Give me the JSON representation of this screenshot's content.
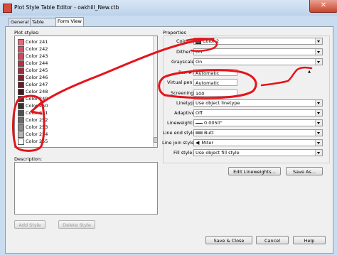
{
  "window": {
    "title": "Plot Style Table Editor - oakhill_New.ctb",
    "close_glyph": "✕"
  },
  "tabs": [
    {
      "label": "General"
    },
    {
      "label": "Table View"
    },
    {
      "label": "Form View"
    }
  ],
  "plot_styles": {
    "label": "Plot styles:",
    "items": [
      {
        "label": "Color 241",
        "color": "#e8677a"
      },
      {
        "label": "Color 242",
        "color": "#d94e68"
      },
      {
        "label": "Color 243",
        "color": "#c84a5c"
      },
      {
        "label": "Color 244",
        "color": "#b43048"
      },
      {
        "label": "Color 245",
        "color": "#9a2c42"
      },
      {
        "label": "Color 246",
        "color": "#7f2030"
      },
      {
        "label": "Color 247",
        "color": "#6a1a28"
      },
      {
        "label": "Color 248",
        "color": "#4a121c"
      },
      {
        "label": "Color 249",
        "color": "#3a3a3a"
      },
      {
        "label": "Color 250",
        "color": "#333333"
      },
      {
        "label": "Color 251",
        "color": "#505050"
      },
      {
        "label": "Color 252",
        "color": "#6b6b6b"
      },
      {
        "label": "Color 253",
        "color": "#8a8a8a"
      },
      {
        "label": "Color 254",
        "color": "#b4b4b4"
      },
      {
        "label": "Color 255",
        "color": "#ffffff"
      }
    ]
  },
  "description": {
    "label": "Description:"
  },
  "buttons": {
    "add_style": "Add Style",
    "delete_style": "Delete Style",
    "edit_lineweights": "Edit Lineweights...",
    "save_as": "Save As...",
    "save_close": "Save & Close",
    "cancel": "Cancel",
    "help": "Help"
  },
  "properties": {
    "label": "Properties",
    "color": {
      "label": "Color:",
      "value": "Color 2"
    },
    "dither": {
      "label": "Dither:",
      "value": "On"
    },
    "grayscale": {
      "label": "Grayscale:",
      "value": "On"
    },
    "pen": {
      "label": "Pen #:",
      "value": "Automatic"
    },
    "virtual_pen": {
      "label": "Virtual pen #:",
      "value": "Automatic"
    },
    "screening": {
      "label": "Screening:",
      "value": "100"
    },
    "linetype": {
      "label": "Linetype:",
      "value": "Use object linetype"
    },
    "adaptive": {
      "label": "Adaptive:",
      "value": "Off"
    },
    "lineweight": {
      "label": "Lineweight:",
      "value": "0.0050\""
    },
    "line_end_style": {
      "label": "Line end style:",
      "value": "Butt"
    },
    "line_join_style": {
      "label": "Line join style:",
      "value": "Miter"
    },
    "fill_style": {
      "label": "Fill style:",
      "value": "Use object fill style"
    }
  }
}
